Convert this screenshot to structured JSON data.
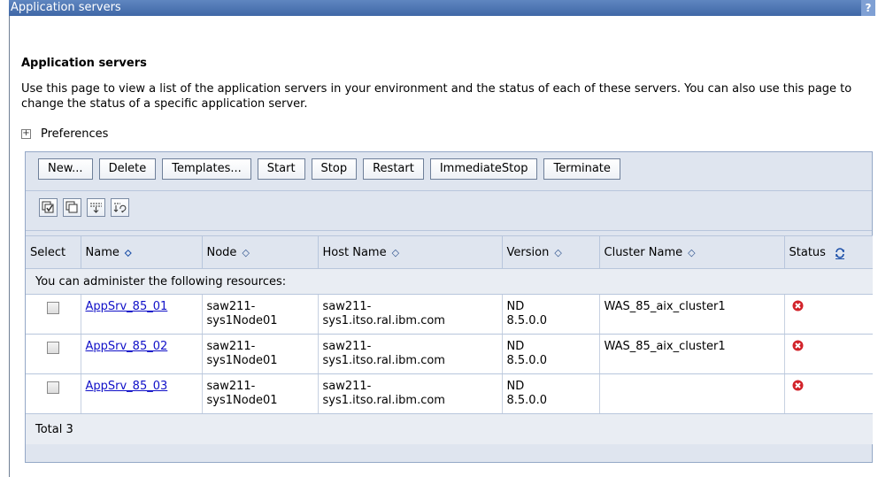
{
  "window": {
    "title": "Application servers",
    "help_label": "?"
  },
  "page": {
    "heading": "Application servers",
    "description": "Use this page to view a list of the application servers in your environment and the status of each of these servers. You can also use this page to change the status of a specific application server.",
    "preferences_label": "Preferences",
    "preferences_toggle": "+"
  },
  "toolbar": {
    "buttons": [
      "New...",
      "Delete",
      "Templates...",
      "Start",
      "Stop",
      "Restart",
      "ImmediateStop",
      "Terminate"
    ]
  },
  "icon_toolbar": {
    "icons": [
      "select-all-icon",
      "deselect-all-icon",
      "show-filter-icon",
      "clear-filter-icon"
    ]
  },
  "table": {
    "columns": {
      "select": "Select",
      "name": "Name",
      "node": "Node",
      "host": "Host Name",
      "version": "Version",
      "cluster": "Cluster Name",
      "status": "Status"
    },
    "note": "You can administer the following resources:",
    "rows": [
      {
        "name": "AppSrv_85_01",
        "node_l1": "saw211-",
        "node_l2": "sys1Node01",
        "host_l1": "saw211-",
        "host_l2": "sys1.itso.ral.ibm.com",
        "version_l1": "ND",
        "version_l2": "8.5.0.0",
        "cluster": "WAS_85_aix_cluster1",
        "status": "stopped"
      },
      {
        "name": "AppSrv_85_02",
        "node_l1": "saw211-",
        "node_l2": "sys1Node01",
        "host_l1": "saw211-",
        "host_l2": "sys1.itso.ral.ibm.com",
        "version_l1": "ND",
        "version_l2": "8.5.0.0",
        "cluster": "WAS_85_aix_cluster1",
        "status": "stopped"
      },
      {
        "name": "AppSrv_85_03",
        "node_l1": "saw211-",
        "node_l2": "sys1Node01",
        "host_l1": "saw211-",
        "host_l2": "sys1.itso.ral.ibm.com",
        "version_l1": "ND",
        "version_l2": "8.5.0.0",
        "cluster": "",
        "status": "stopped"
      }
    ],
    "total": "Total 3"
  },
  "colors": {
    "titlebar": "#4a72b0",
    "panel": "#dfe5ef",
    "link": "#1010c8",
    "status_stopped": "#d2232a"
  }
}
